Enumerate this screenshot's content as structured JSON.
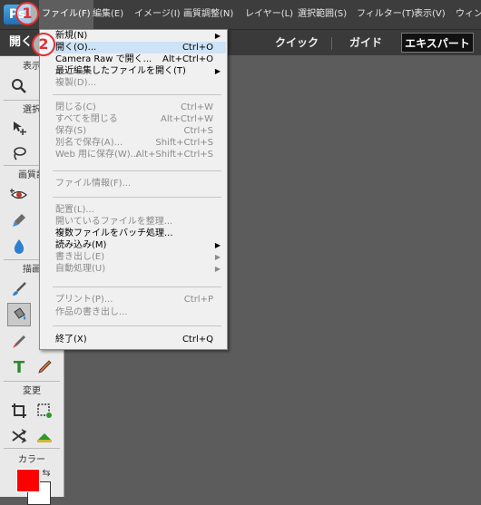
{
  "app": {
    "logo_text": "Ps"
  },
  "menubar": {
    "items": [
      {
        "id": "file",
        "label": "ファイル(F)"
      },
      {
        "id": "edit",
        "label": "編集(E)"
      },
      {
        "id": "image",
        "label": "イメージ(I)"
      },
      {
        "id": "adjust",
        "label": "画質調整(N)"
      },
      {
        "id": "layer",
        "label": "レイヤー(L)"
      },
      {
        "id": "select",
        "label": "選択範囲(S)"
      },
      {
        "id": "filter",
        "label": "フィルター(T)"
      },
      {
        "id": "view",
        "label": "表示(V)"
      },
      {
        "id": "window",
        "label": "ウィント"
      }
    ]
  },
  "steps": {
    "one": "1",
    "two": "2"
  },
  "modebar": {
    "open_label": "開く",
    "tabs": [
      {
        "label": "クイック"
      },
      {
        "label": "ガイド"
      },
      {
        "label": "エキスパート"
      }
    ]
  },
  "toolpanel": {
    "sections": {
      "view": "表示",
      "select": "選択",
      "enhance": "画質調",
      "draw": "描画",
      "modify": "変更",
      "color": "カラー"
    },
    "colors": {
      "foreground": "#ff0000",
      "background": "#ffffff"
    }
  },
  "file_menu": {
    "items": [
      {
        "label": "新規(N)",
        "shortcut": "",
        "submenu": true,
        "disabled": false
      },
      {
        "label": "開く(O)...",
        "shortcut": "Ctrl+O",
        "submenu": false,
        "disabled": false,
        "highlight": true
      },
      {
        "label": "Camera Raw で開く...",
        "shortcut": "Alt+Ctrl+O",
        "submenu": false,
        "disabled": false
      },
      {
        "label": "最近編集したファイルを開く(T)",
        "shortcut": "",
        "submenu": true,
        "disabled": false
      },
      {
        "label": "複製(D)...",
        "shortcut": "",
        "submenu": false,
        "disabled": true
      },
      {
        "label": "閉じる(C)",
        "shortcut": "Ctrl+W",
        "submenu": false,
        "disabled": true
      },
      {
        "label": "すべてを閉じる",
        "shortcut": "Alt+Ctrl+W",
        "submenu": false,
        "disabled": true
      },
      {
        "label": "保存(S)",
        "shortcut": "Ctrl+S",
        "submenu": false,
        "disabled": true
      },
      {
        "label": "別名で保存(A)...",
        "shortcut": "Shift+Ctrl+S",
        "submenu": false,
        "disabled": true
      },
      {
        "label": "Web 用に保存(W)...",
        "shortcut": "Alt+Shift+Ctrl+S",
        "submenu": false,
        "disabled": true
      },
      {
        "label": "ファイル情報(F)...",
        "shortcut": "",
        "submenu": false,
        "disabled": true
      },
      {
        "label": "配置(L)...",
        "shortcut": "",
        "submenu": false,
        "disabled": true
      },
      {
        "label": "開いているファイルを整理...",
        "shortcut": "",
        "submenu": false,
        "disabled": true
      },
      {
        "label": "複数ファイルをバッチ処理...",
        "shortcut": "",
        "submenu": false,
        "disabled": false
      },
      {
        "label": "読み込み(M)",
        "shortcut": "",
        "submenu": true,
        "disabled": false
      },
      {
        "label": "書き出し(E)",
        "shortcut": "",
        "submenu": true,
        "disabled": true
      },
      {
        "label": "自動処理(U)",
        "shortcut": "",
        "submenu": true,
        "disabled": true
      },
      {
        "label": "プリント(P)...",
        "shortcut": "Ctrl+P",
        "submenu": false,
        "disabled": true
      },
      {
        "label": "作品の書き出し...",
        "shortcut": "",
        "submenu": false,
        "disabled": true
      },
      {
        "label": "終了(X)",
        "shortcut": "Ctrl+Q",
        "submenu": false,
        "disabled": false
      }
    ],
    "submenu_arrow": "▶"
  }
}
